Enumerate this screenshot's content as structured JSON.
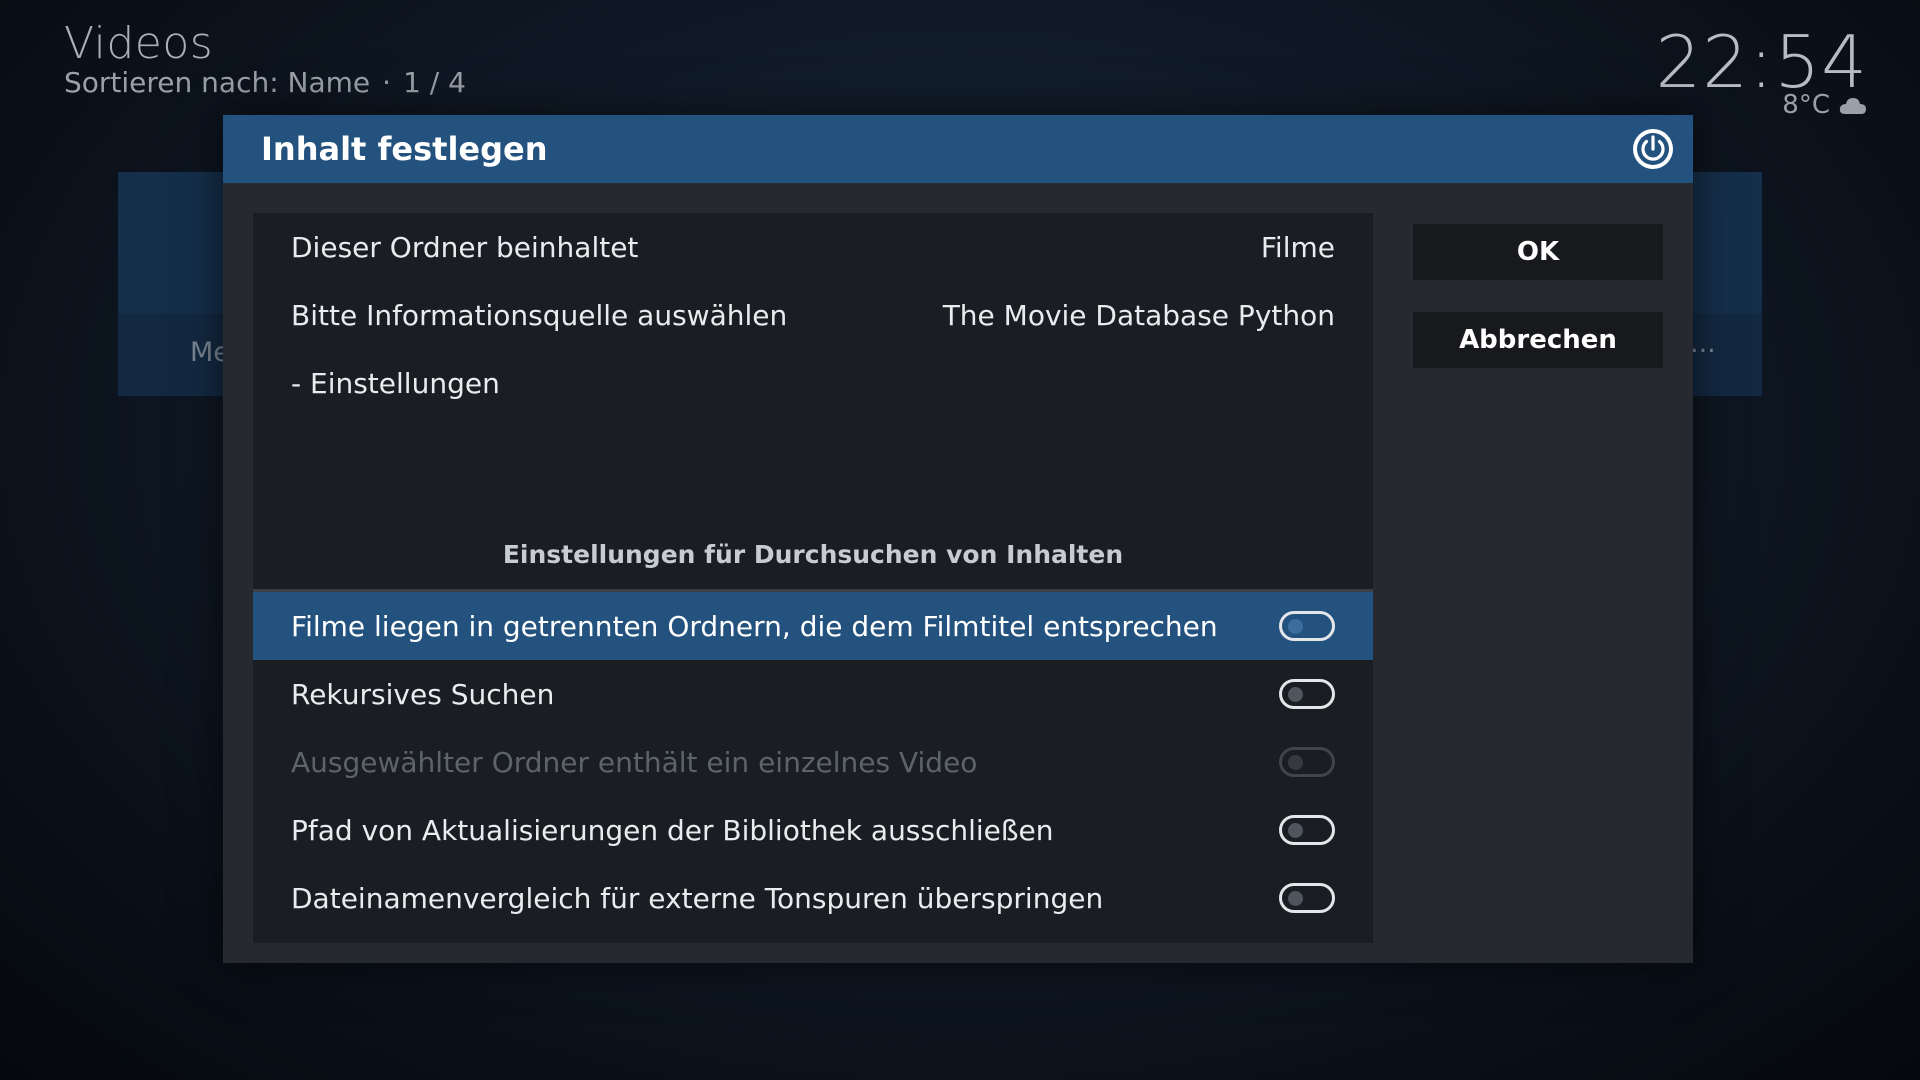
{
  "header": {
    "title": "Videos",
    "sort_label": "Sortieren nach: Name",
    "separator": "·",
    "position": "1 / 4"
  },
  "clock": {
    "time": "22:54",
    "temperature": "8°C",
    "weather_icon": "cloud-icon"
  },
  "background": {
    "menu_text": "Me",
    "ellipsis": "..."
  },
  "dialog": {
    "title": "Inhalt festlegen",
    "close_icon": "power-icon",
    "rows": {
      "content_type": {
        "label": "Dieser Ordner beinhaltet",
        "value": "Filme"
      },
      "scraper": {
        "label": "Bitte Informationsquelle auswählen",
        "value": "The Movie Database Python"
      },
      "settings": {
        "label": "- Einstellungen"
      }
    },
    "section_title": "Einstellungen für Durchsuchen von Inhalten",
    "options": [
      {
        "label": "Filme liegen in getrennten Ordnern, die dem Filmtitel entsprechen",
        "enabled": false,
        "focused": true,
        "disabled": false
      },
      {
        "label": "Rekursives Suchen",
        "enabled": false,
        "focused": false,
        "disabled": false
      },
      {
        "label": "Ausgewählter Ordner enthält ein einzelnes Video",
        "enabled": false,
        "focused": false,
        "disabled": true
      },
      {
        "label": "Pfad von Aktualisierungen der Bibliothek ausschließen",
        "enabled": false,
        "focused": false,
        "disabled": false
      },
      {
        "label": "Dateinamenvergleich für externe Tonspuren überspringen",
        "enabled": false,
        "focused": false,
        "disabled": false
      }
    ],
    "buttons": {
      "ok": "OK",
      "cancel": "Abbrechen"
    }
  },
  "colors": {
    "accent": "#24527f",
    "panel": "#1a1d22",
    "dialog": "#262a30"
  }
}
